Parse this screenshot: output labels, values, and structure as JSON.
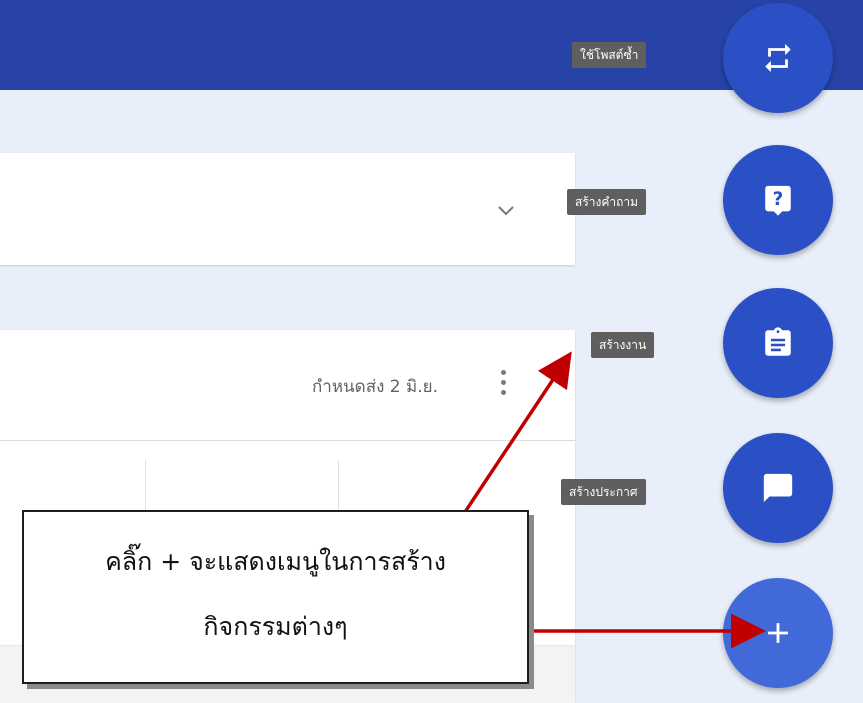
{
  "main": {
    "assignment": {
      "due_text": "กำหนดส่ง 2 มิ.ย."
    }
  },
  "fab_menu": {
    "reuse_post": {
      "label": "ใช้โพสต์ซ้ำ",
      "icon": "repeat-icon"
    },
    "create_question": {
      "label": "สร้างคำถาม",
      "icon": "question-icon"
    },
    "create_assignment": {
      "label": "สร้างงาน",
      "icon": "clipboard-icon"
    },
    "create_announcement": {
      "label": "สร้างประกาศ",
      "icon": "chat-bubble-icon"
    },
    "add": {
      "label": "+",
      "icon": "plus-icon"
    }
  },
  "callout": {
    "line1": "คลิ๊ก + จะแสดงเมนูในการสร้าง",
    "line2": "กิจกรรมต่างๆ"
  },
  "colors": {
    "header_blue": "#2743a8",
    "fab_blue": "#2b4fc4",
    "arrow_red": "#c00000"
  }
}
